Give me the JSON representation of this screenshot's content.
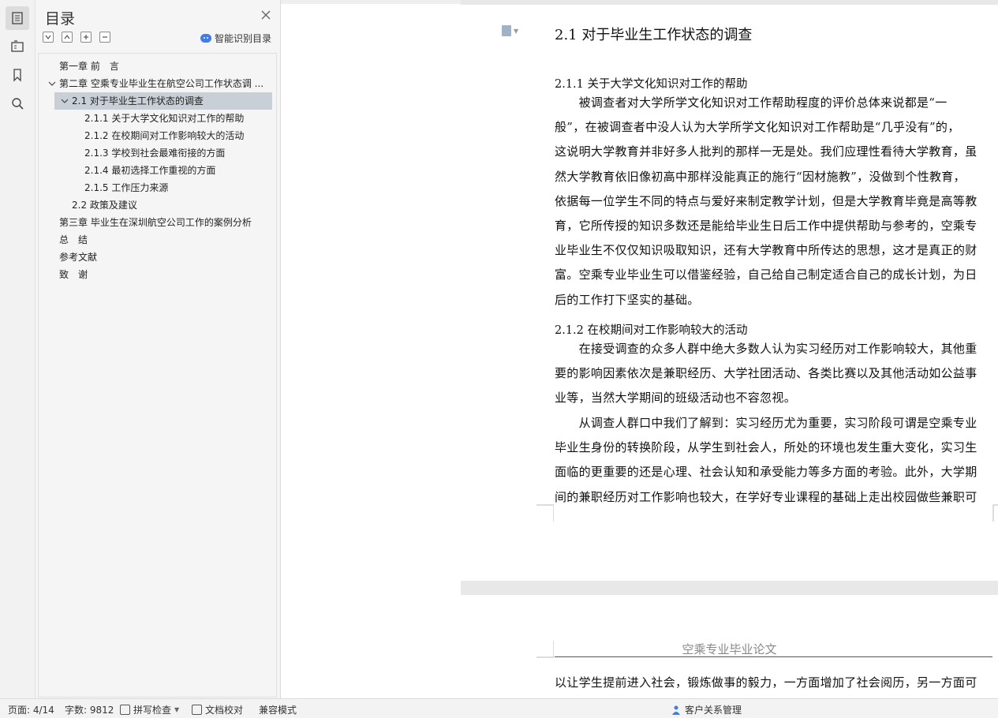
{
  "toc": {
    "title": "目录",
    "smart_label": "智能识别目录",
    "items": [
      {
        "label": "第一章 前　言",
        "indent": 0,
        "chevron": false,
        "selected": false
      },
      {
        "label": "第二章 空乘专业毕业生在航空公司工作状态调 ...",
        "indent": 0,
        "chevron": true,
        "selected": false
      },
      {
        "label": "2.1  对于毕业生工作状态的调查",
        "indent": 1,
        "chevron": true,
        "selected": true
      },
      {
        "label": "2.1.1 关于大学文化知识对工作的帮助",
        "indent": 2,
        "chevron": false,
        "selected": false
      },
      {
        "label": "2.1.2  在校期间对工作影响较大的活动",
        "indent": 2,
        "chevron": false,
        "selected": false
      },
      {
        "label": "2.1.3 学校到社会最难衔接的方面",
        "indent": 2,
        "chevron": false,
        "selected": false
      },
      {
        "label": "2.1.4 最初选择工作重视的方面",
        "indent": 2,
        "chevron": false,
        "selected": false
      },
      {
        "label": "2.1.5 工作压力来源",
        "indent": 2,
        "chevron": false,
        "selected": false
      },
      {
        "label": "2.2  政策及建议",
        "indent": 1,
        "chevron": false,
        "selected": false
      },
      {
        "label": "第三章 毕业生在深圳航空公司工作的案例分析",
        "indent": 0,
        "chevron": false,
        "selected": false
      },
      {
        "label": "总　结",
        "indent": 0,
        "chevron": false,
        "selected": false
      },
      {
        "label": "参考文献",
        "indent": 0,
        "chevron": false,
        "selected": false
      },
      {
        "label": "致　谢",
        "indent": 0,
        "chevron": false,
        "selected": false
      }
    ]
  },
  "doc": {
    "heading": "2.1  对于毕业生工作状态的调查",
    "sub1": "2.1.1 关于大学文化知识对工作的帮助",
    "para1": [
      "　　被调查者对大学所学文化知识对工作帮助程度的评价总体来说都是“一",
      "般”，在被调查者中没人认为大学所学文化知识对工作帮助是“几乎没有”的，",
      "这说明大学教育并非好多人批判的那样一无是处。我们应理性看待大学教育，虽",
      "然大学教育依旧像初高中那样没能真正的施行“因材施教”，没做到个性教育，",
      "依据每一位学生不同的特点与爱好来制定教学计划，但是大学教育毕竟是高等教",
      "育，它所传授的知识多数还是能给毕业生日后工作中提供帮助与参考的，空乘专",
      "业毕业生不仅仅知识吸取知识，还有大学教育中所传达的思想，这才是真正的财",
      "富。空乘专业毕业生可以借鉴经验，自己给自己制定适合自己的成长计划，为日",
      "后的工作打下坚实的基础。"
    ],
    "sub2": "2.1.2  在校期间对工作影响较大的活动",
    "para2": [
      "　　在接受调查的众多人群中绝大多数人认为实习经历对工作影响较大，其他重",
      "要的影响因素依次是兼职经历、大学社团活动、各类比赛以及其他活动如公益事",
      "业等，当然大学期间的班级活动也不容忽视。"
    ],
    "para3": [
      "　　从调查人群口中我们了解到：实习经历尤为重要，实习阶段可谓是空乘专业",
      "毕业生身份的转换阶段，从学生到社会人，所处的环境也发生重大变化，实习生",
      "面临的更重要的还是心理、社会认知和承受能力等多方面的考验。此外，大学期",
      "间的兼职经历对工作影响也较大，在学好专业课程的基础上走出校园做些兼职可"
    ],
    "page2_header": "空乘专业毕业论文",
    "page2_line": "以让学生提前进入社会，锻炼做事的毅力，一方面增加了社会阅历，另一方面可"
  },
  "status": {
    "page": "页面: 4/14",
    "words": "字数: 9812",
    "spell": "拼写检查",
    "proof": "文档校对",
    "compat": "兼容模式",
    "crm": "客户关系管理"
  }
}
